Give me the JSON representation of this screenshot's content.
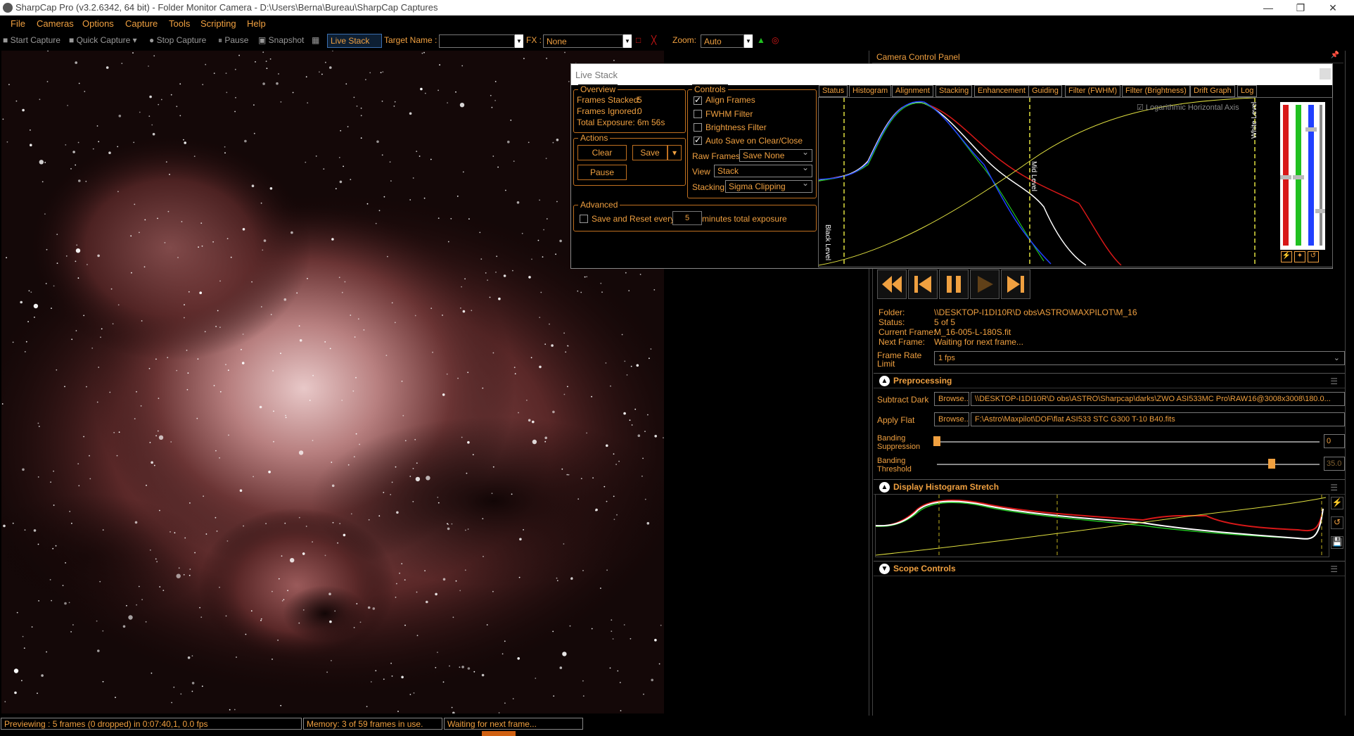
{
  "window": {
    "title": "SharpCap Pro (v3.2.6342, 64 bit) - Folder Monitor Camera - D:\\Users\\Berna\\Bureau\\SharpCap Captures",
    "minimize": "—",
    "restore": "❐",
    "close": "✕"
  },
  "menu": [
    "File",
    "Cameras",
    "Options",
    "Capture",
    "Tools",
    "Scripting",
    "Help"
  ],
  "toolbar": {
    "start_capture": "Start Capture",
    "quick_capture": "Quick Capture",
    "stop_capture": "Stop Capture",
    "pause": "Pause",
    "snapshot": "Snapshot",
    "live_stack": "Live Stack",
    "target_name_label": "Target Name :",
    "target_name_value": "",
    "fx_label": "FX :",
    "fx_value": "None",
    "zoom_label": "Zoom:",
    "zoom_value": "Auto"
  },
  "camera_panel_title": "Camera Control Panel",
  "live_stack": {
    "title": "Live Stack",
    "overview": {
      "label": "Overview",
      "frames_stacked_label": "Frames Stacked:",
      "frames_stacked": "5",
      "frames_ignored_label": "Frames Ignored:",
      "frames_ignored": "0",
      "total_exposure_label": "Total Exposure:",
      "total_exposure": "6m 56s"
    },
    "actions": {
      "label": "Actions",
      "clear": "Clear",
      "save": "Save",
      "pause": "Pause"
    },
    "controls": {
      "label": "Controls",
      "align_frames": "Align Frames",
      "fwhm_filter": "FWHM Filter",
      "brightness_filter": "Brightness Filter",
      "auto_save": "Auto Save on Clear/Close",
      "raw_frames_label": "Raw Frames",
      "raw_frames_value": "Save None",
      "view_label": "View",
      "view_value": "Stack",
      "stacking_label": "Stacking",
      "stacking_value": "Sigma Clipping"
    },
    "advanced": {
      "label": "Advanced",
      "save_reset_label": "Save and Reset every",
      "minutes_value": "5",
      "minutes_suffix": "minutes total exposure"
    },
    "tabs": [
      "Status",
      "Histogram",
      "Alignment",
      "Stacking",
      "Enhancement",
      "Guiding",
      "Filter (FWHM)",
      "Filter (Brightness)",
      "Drift Graph",
      "Log"
    ],
    "histogram": {
      "log_axis_label": "Logarithmic Horizontal Axis",
      "black_level": "Black Level",
      "mid_level": "Mid Level",
      "white_level": "White Level"
    }
  },
  "folder_monitor": {
    "folder_label": "Folder:",
    "folder_value": "\\\\DESKTOP-I1DI10R\\D obs\\ASTRO\\MAXPILOT\\M_16",
    "status_label": "Status:",
    "status_value": "5 of 5",
    "current_frame_label": "Current Frame:",
    "current_frame_value": "M_16-005-L-180S.fit",
    "next_frame_label": "Next Frame:",
    "next_frame_value": "Waiting for next frame...",
    "frame_rate_label_1": "Frame Rate",
    "frame_rate_label_2": "Limit",
    "frame_rate_value": "1 fps"
  },
  "preprocessing": {
    "title": "Preprocessing",
    "subtract_dark_label": "Subtract Dark",
    "browse": "Browse...",
    "subtract_dark_value": "\\\\DESKTOP-I1DI10R\\D obs\\ASTRO\\Sharpcap\\darks\\ZWO ASI533MC Pro\\RAW16@3008x3008\\180.0...",
    "apply_flat_label": "Apply Flat",
    "apply_flat_value": "F:\\Astro\\Maxpilot\\DOF\\flat ASI533 STC G300 T-10 B40.fits",
    "banding_suppression_1": "Banding",
    "banding_suppression_2": "Suppression",
    "banding_suppression_value": "0",
    "banding_suppression_level": 0.0,
    "banding_threshold_1": "Banding",
    "banding_threshold_2": "Threshold",
    "banding_threshold_value": "35.0",
    "banding_threshold_level": 0.875
  },
  "display_stretch": {
    "title": "Display Histogram Stretch"
  },
  "scope_controls": {
    "title": "Scope Controls"
  },
  "status_bar": {
    "preview": "Previewing : 5 frames (0 dropped) in 0:07:40,1, 0.0 fps",
    "memory": "Memory: 3 of 59 frames in use.",
    "waiting": "Waiting for next frame..."
  },
  "colors": {
    "accent": "#f0a040",
    "red": "#d81818",
    "green": "#20c020",
    "blue": "#2040ff",
    "yellow": "#e0e040"
  }
}
